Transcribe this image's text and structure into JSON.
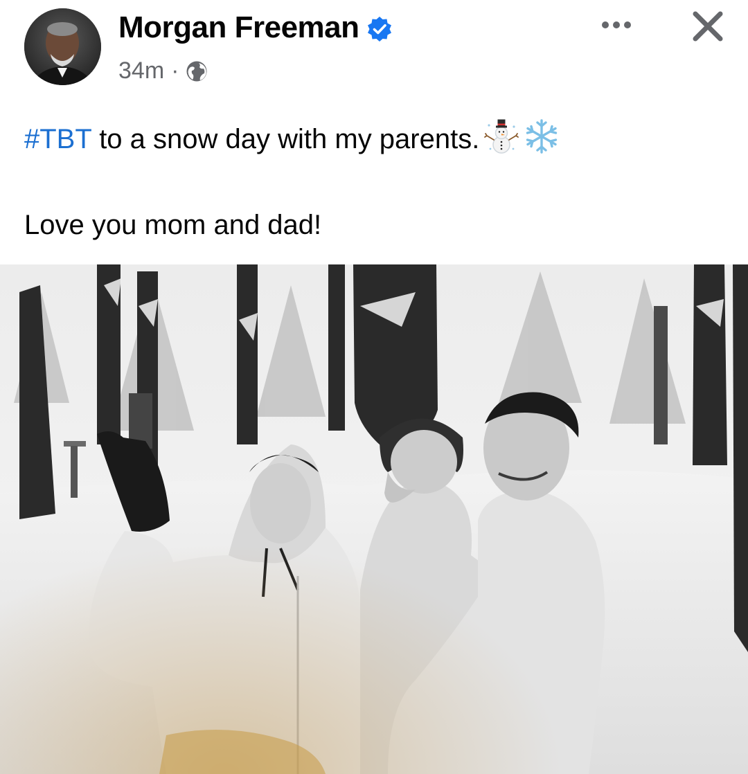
{
  "post": {
    "author": "Morgan Freeman",
    "verified": true,
    "time": "34m",
    "separator": "·",
    "audience_icon": "globe-icon",
    "text": {
      "hashtag": "#TBT",
      "line1_rest": " to a snow day with my parents.",
      "line1_emojis": [
        "snowman-emoji",
        "snowflake-emoji"
      ],
      "line2": "Love you mom and dad!"
    },
    "photo": {
      "kind": "black-and-white-family-photo-in-snow"
    }
  },
  "actions": {
    "more_icon": "more-options-icon",
    "close_icon": "close-icon"
  },
  "colors": {
    "hashtag": "#1b6fd1",
    "verified_badge": "#1877f2",
    "meta_text": "#65676b",
    "text": "#050505"
  }
}
